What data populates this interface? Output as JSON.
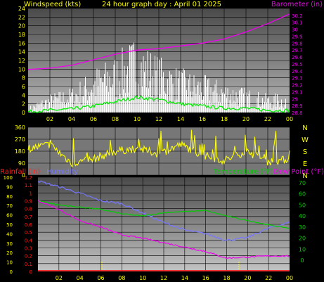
{
  "header": {
    "left": "Windspeed (kts)",
    "center": "24 hour graph day : April 01 2025",
    "right": "Barometer (in)"
  },
  "colors": {
    "wind": "#ffffff",
    "gust_grid": "#ffffff",
    "wind_avg": "#00ee00",
    "barometer": "#ee00ee",
    "direction": "#ffff00",
    "rain": "#ff2020",
    "humidity": "#7777ff",
    "temperature": "#00cc00",
    "dewpoint": "#ee00ee",
    "tick_label": "#ffff00"
  },
  "chart_data": [
    {
      "type": "area",
      "title": "Windspeed (kts) / Barometer (in)",
      "x": [
        "00",
        "02",
        "04",
        "06",
        "08",
        "10",
        "12",
        "14",
        "16",
        "18",
        "20",
        "22",
        "00"
      ],
      "x_tick_labels": [
        "02",
        "04",
        "06",
        "08",
        "10",
        "12",
        "14",
        "16",
        "18",
        "20",
        "22",
        "00"
      ],
      "ylabel_left": "Windspeed (kts)",
      "ylim_left": [
        0,
        24
      ],
      "y_ticks_left": [
        "0",
        "2",
        "4",
        "6",
        "8",
        "10",
        "12",
        "14",
        "16",
        "18",
        "20",
        "22",
        "24"
      ],
      "ylabel_right": "Barometer (in)",
      "ylim_right": [
        28.8,
        30.3
      ],
      "y_ticks_right": [
        "28.8",
        "28.9",
        "29",
        "29.1",
        "29.2",
        "29.3",
        "29.4",
        "29.5",
        "29.6",
        "29.7",
        "29.8",
        "29.9",
        "30",
        "30.1",
        "30.2"
      ],
      "series": [
        {
          "name": "Windspeed (kts)",
          "values": [
            1,
            3,
            4,
            7,
            9,
            12,
            9,
            7,
            6,
            5,
            4,
            3,
            3
          ]
        },
        {
          "name": "Average",
          "values": [
            0.2,
            0.5,
            0.8,
            1.5,
            2.5,
            3.5,
            3.0,
            2.0,
            1.5,
            1.0,
            1.0,
            0.5,
            0.5
          ]
        },
        {
          "name": "Barometer (in)",
          "values": [
            29.42,
            29.44,
            29.48,
            29.56,
            29.64,
            29.7,
            29.72,
            29.76,
            29.8,
            29.86,
            29.96,
            30.08,
            30.22
          ]
        }
      ],
      "grid": true
    },
    {
      "type": "line",
      "title": "Wind direction",
      "x": [
        "00",
        "02",
        "04",
        "06",
        "08",
        "10",
        "12",
        "14",
        "16",
        "18",
        "20",
        "22",
        "00"
      ],
      "ylim": [
        0,
        360
      ],
      "y_ticks": [
        "0",
        "90",
        "180",
        "270",
        "360"
      ],
      "compass_labels": [
        "N",
        "W",
        "S",
        "E",
        "N"
      ],
      "series": [
        {
          "name": "Direction",
          "values": [
            200,
            230,
            90,
            120,
            180,
            200,
            160,
            230,
            150,
            110,
            180,
            100,
            120
          ]
        }
      ],
      "grid": true
    },
    {
      "type": "line",
      "title": "Rainfall / Humidity / Temperature / Dew Point",
      "x": [
        "00",
        "02",
        "04",
        "06",
        "08",
        "10",
        "12",
        "14",
        "16",
        "18",
        "20",
        "22",
        "00"
      ],
      "x_tick_labels": [
        "02",
        "04",
        "06",
        "08",
        "10",
        "12",
        "14",
        "16",
        "18",
        "20",
        "22",
        "00"
      ],
      "legend_left": [
        "Rainfall (in)",
        "Humidity"
      ],
      "legend_right": [
        "Temperature (°F)",
        "Dew Point (°F)"
      ],
      "humidity_axis": {
        "ylim": [
          0,
          100
        ],
        "ticks": [
          "0",
          "10",
          "20",
          "30",
          "40",
          "50",
          "60",
          "70",
          "80",
          "90",
          "100"
        ]
      },
      "rain_axis": {
        "ylim": [
          0,
          1.2
        ],
        "ticks": [
          "0",
          "0.1",
          "0.2",
          "0.3",
          "0.4",
          "0.5",
          "0.6",
          "0.7",
          "0.8",
          "0.9",
          "1",
          "1.1",
          "1.2"
        ]
      },
      "temp_axis": {
        "ylim": [
          -10,
          75
        ],
        "ticks": [
          "0",
          "10",
          "20",
          "30",
          "40",
          "50",
          "60",
          "70"
        ]
      },
      "series": [
        {
          "name": "Rainfall (in)",
          "values": [
            0.01,
            0.01,
            0.01,
            0.01,
            0.01,
            0.01,
            0.01,
            0.01,
            0.01,
            0.01,
            0.01,
            0.01,
            0.01
          ]
        },
        {
          "name": "Humidity",
          "values": [
            96,
            90,
            83,
            75,
            72,
            62,
            52,
            44,
            40,
            33,
            36,
            46,
            52
          ]
        },
        {
          "name": "Temperature (°F)",
          "values": [
            54,
            50,
            48,
            46,
            42,
            40,
            43,
            44,
            45,
            40,
            36,
            32,
            29
          ]
        },
        {
          "name": "Dew Point (°F)",
          "values": [
            54,
            46,
            36,
            30,
            23,
            20,
            16,
            12,
            8,
            2,
            3,
            4,
            4
          ]
        }
      ],
      "grid": true
    }
  ]
}
